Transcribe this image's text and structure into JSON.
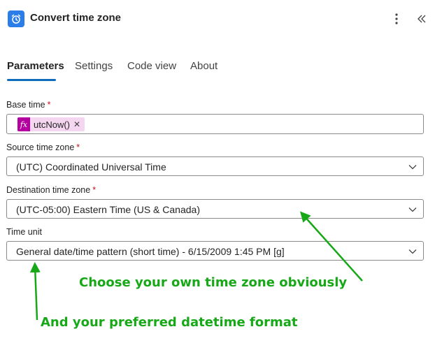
{
  "header": {
    "title": "Convert time zone",
    "icon": "alarm-clock-icon",
    "menu_icon": "more-vertical-icon",
    "collapse_icon": "double-chevron-left-icon"
  },
  "tabs": [
    {
      "label": "Parameters",
      "active": true
    },
    {
      "label": "Settings"
    },
    {
      "label": "Code view"
    },
    {
      "label": "About"
    }
  ],
  "fields": {
    "base_time": {
      "label": "Base time",
      "required_mark": "*",
      "token": "utcNow()",
      "token_icon": "fx"
    },
    "source_tz": {
      "label": "Source time zone",
      "required_mark": "*",
      "value": "(UTC) Coordinated Universal Time"
    },
    "dest_tz": {
      "label": "Destination time zone",
      "required_mark": "*",
      "value": "(UTC-05:00) Eastern Time (US & Canada)"
    },
    "time_unit": {
      "label": "Time unit",
      "value": "General date/time pattern (short time) - 6/15/2009 1:45 PM [g]"
    }
  },
  "annotations": {
    "note1": "Choose your own time zone obviously",
    "note2": "And your preferred datetime format",
    "color": "#17a817"
  },
  "colors": {
    "accent": "#0f6cbd",
    "token_bg": "#f5d6f1",
    "fx_bg": "#b4009e",
    "app_icon_bg": "#2b7de9",
    "required": "#c50f1f"
  }
}
